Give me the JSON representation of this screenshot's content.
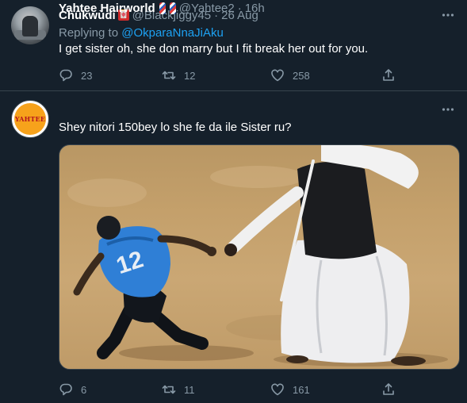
{
  "tweets": [
    {
      "display_name": "Chûkwùdí",
      "emoji": "🀄",
      "handle": "@Blackjiggy45",
      "separator": "·",
      "time": "26 Aug",
      "replying_to_prefix": "Replying to",
      "replying_to_user": "@OkparaNnaJiAku",
      "text": "I get sister oh, she don marry but I fit break her out for you.",
      "replies": "23",
      "retweets": "12",
      "likes": "258"
    },
    {
      "display_name": "Yahtee Hairworld",
      "emoji": "💈💈",
      "avatar_logo_text": "YAHTEE",
      "handle": "@Yahtee2",
      "separator": "·",
      "time": "16h",
      "text": "Shey nitori 150bey lo she fe da ile Sister ru?",
      "replies": "6",
      "retweets": "11",
      "likes": "161",
      "image_jersey_number": "12"
    }
  ],
  "colors": {
    "background": "#15202b",
    "text_primary": "#ffffff",
    "text_secondary": "#8899a6",
    "link": "#1da1f2",
    "divider": "#38444d"
  },
  "icons": [
    "more-icon",
    "reply-icon",
    "retweet-icon",
    "like-icon",
    "share-icon"
  ]
}
